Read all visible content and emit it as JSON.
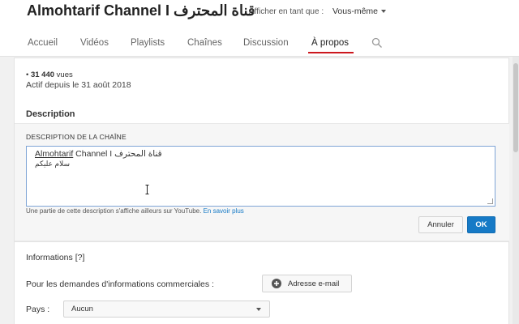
{
  "header": {
    "channel_name": "Almohtarif Channel I قناة المحترف",
    "view_as_label": "Afficher en tant que :",
    "view_as_value": "Vous-même"
  },
  "tabs": [
    {
      "label": "Accueil"
    },
    {
      "label": "Vidéos"
    },
    {
      "label": "Playlists"
    },
    {
      "label": "Chaînes"
    },
    {
      "label": "Discussion"
    },
    {
      "label": "À propos",
      "active": true
    }
  ],
  "stats": {
    "views_prefix": "• ",
    "views_count": "31 440",
    "views_suffix": " vues",
    "joined": "Actif depuis le 31 août 2018"
  },
  "description_section": {
    "title": "Description",
    "edit_label": "DESCRIPTION DE LA CHAÎNE",
    "text_line1_underlined": "Almohtarif",
    "text_line1_rest": " Channel I قناة المحترف",
    "text_line2": "سلام عليكم",
    "help_text": "Une partie de cette description s'affiche ailleurs sur YouTube.",
    "help_link": "En savoir plus",
    "cancel_label": "Annuler",
    "ok_label": "OK"
  },
  "info_section": {
    "title": "Informations [?]",
    "business_label": "Pour les demandes d'informations commerciales :",
    "email_button_label": "Adresse e-mail",
    "country_label": "Pays :",
    "country_value": "Aucun"
  },
  "colors": {
    "accent": "#cc181e",
    "link": "#167ac6",
    "primary_button": "#167ac6"
  }
}
